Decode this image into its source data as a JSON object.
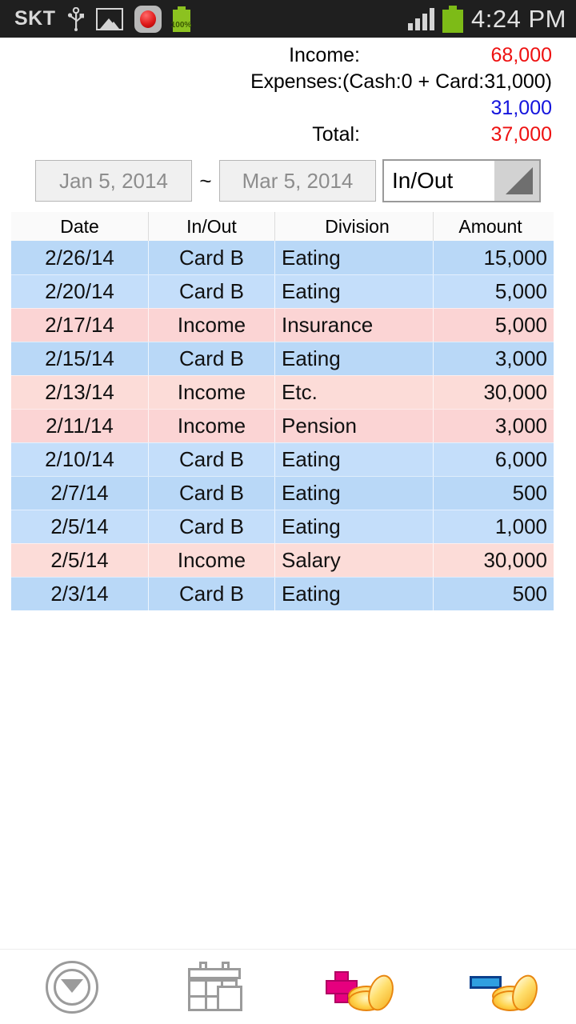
{
  "status_bar": {
    "carrier": "SKT",
    "battery_pct_label": "100%",
    "time": "4:24 PM",
    "icons": [
      "usb-icon",
      "image-icon",
      "record-icon",
      "battery-icon",
      "signal-icon",
      "battery-icon"
    ]
  },
  "summary": {
    "income_label": "Income:",
    "income_value": "68,000",
    "expenses_label": "Expenses:",
    "expenses_breakdown": "(Cash:0 + Card:31,000)",
    "expenses_value": "31,000",
    "total_label": "Total:",
    "total_value": "37,000",
    "income_color": "#ee1111",
    "expenses_color": "#1414dd",
    "total_color": "#ee1111"
  },
  "filter": {
    "start_date": "Jan 5, 2014",
    "separator": "~",
    "end_date": "Mar 5, 2014",
    "spinner_value": "In/Out"
  },
  "table": {
    "headers": [
      "Date",
      "In/Out",
      "Division",
      "Amount"
    ],
    "rows": [
      {
        "date": "2/26/14",
        "io": "Card B",
        "division": "Eating",
        "amount": "15,000",
        "kind": "expense"
      },
      {
        "date": "2/20/14",
        "io": "Card B",
        "division": "Eating",
        "amount": "5,000",
        "kind": "expense"
      },
      {
        "date": "2/17/14",
        "io": "Income",
        "division": "Insurance",
        "amount": "5,000",
        "kind": "income"
      },
      {
        "date": "2/15/14",
        "io": "Card B",
        "division": "Eating",
        "amount": "3,000",
        "kind": "expense"
      },
      {
        "date": "2/13/14",
        "io": "Income",
        "division": "Etc.",
        "amount": "30,000",
        "kind": "income"
      },
      {
        "date": "2/11/14",
        "io": "Income",
        "division": "Pension",
        "amount": "3,000",
        "kind": "income"
      },
      {
        "date": "2/10/14",
        "io": "Card B",
        "division": "Eating",
        "amount": "6,000",
        "kind": "expense"
      },
      {
        "date": "2/7/14",
        "io": "Card B",
        "division": "Eating",
        "amount": "500",
        "kind": "expense"
      },
      {
        "date": "2/5/14",
        "io": "Card B",
        "division": "Eating",
        "amount": "1,000",
        "kind": "expense"
      },
      {
        "date": "2/5/14",
        "io": "Income",
        "division": "Salary",
        "amount": "30,000",
        "kind": "income"
      },
      {
        "date": "2/3/14",
        "io": "Card B",
        "division": "Eating",
        "amount": "500",
        "kind": "expense"
      }
    ]
  },
  "bottom_bar": {
    "items": [
      {
        "name": "collapse-button",
        "icon": "circle-down-arrow-icon"
      },
      {
        "name": "calendar-button",
        "icon": "calendar-icon"
      },
      {
        "name": "add-income-button",
        "icon": "coins-plus-icon"
      },
      {
        "name": "add-expense-button",
        "icon": "coins-minus-icon"
      }
    ]
  }
}
